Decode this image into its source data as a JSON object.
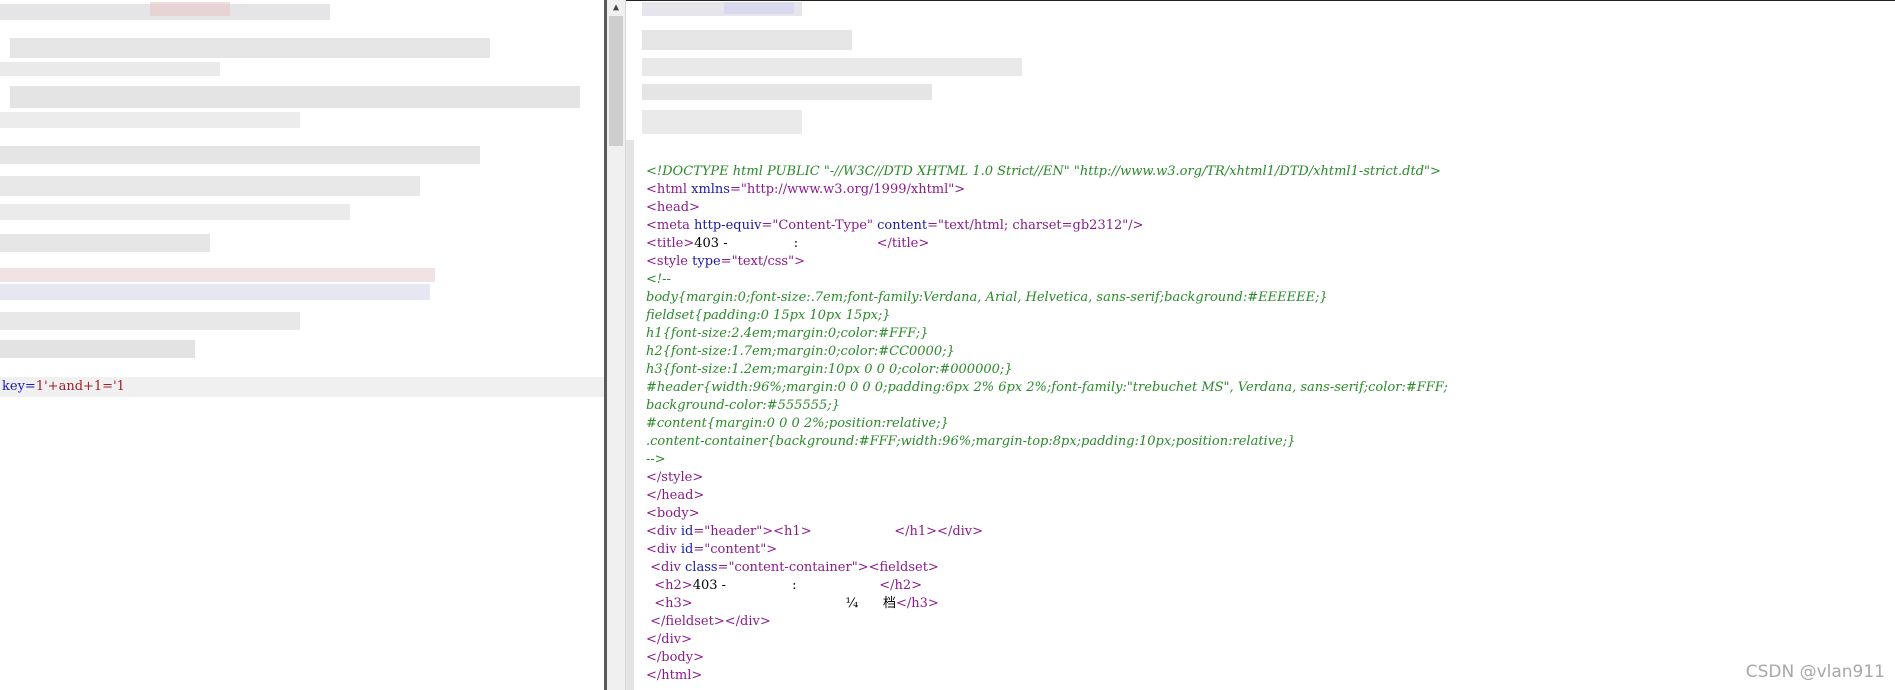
{
  "request": {
    "param_key": "key",
    "param_eq": "=",
    "param_value": "1'+and+1='1"
  },
  "response_lines": [
    [
      [
        "d",
        "<!DOCTYPE html PUBLIC \"-//W3C//DTD XHTML 1.0 Strict//EN\" \"http://www.w3.org/TR/xhtml1/DTD/xhtml1-strict.dtd\">"
      ]
    ],
    [
      [
        "t",
        "<html "
      ],
      [
        "a",
        "xmlns"
      ],
      [
        "t",
        "="
      ],
      [
        "v",
        "\"http://www.w3.org/1999/xhtml\""
      ],
      [
        "t",
        ">"
      ]
    ],
    [
      [
        "t",
        "<head>"
      ]
    ],
    [
      [
        "t",
        "<meta "
      ],
      [
        "a",
        "http-equiv"
      ],
      [
        "t",
        "="
      ],
      [
        "v",
        "\"Content-Type\" "
      ],
      [
        "a",
        "content"
      ],
      [
        "t",
        "="
      ],
      [
        "v",
        "\"text/html; charset=gb2312\""
      ],
      [
        "t",
        "/>"
      ]
    ],
    [
      [
        "t",
        "<title>"
      ],
      [
        "tx",
        "403 -                :                   "
      ],
      [
        "t",
        "</title>"
      ]
    ],
    [
      [
        "t",
        "<style "
      ],
      [
        "a",
        "type"
      ],
      [
        "t",
        "="
      ],
      [
        "v",
        "\"text/css\""
      ],
      [
        "t",
        ">"
      ]
    ],
    [
      [
        "c",
        "<!--"
      ]
    ],
    [
      [
        "c",
        "body{margin:0;font-size:.7em;font-family:Verdana, Arial, Helvetica, sans-serif;background:#EEEEEE;}"
      ]
    ],
    [
      [
        "c",
        "fieldset{padding:0 15px 10px 15px;}"
      ]
    ],
    [
      [
        "c",
        "h1{font-size:2.4em;margin:0;color:#FFF;}"
      ]
    ],
    [
      [
        "c",
        "h2{font-size:1.7em;margin:0;color:#CC0000;}"
      ]
    ],
    [
      [
        "c",
        "h3{font-size:1.2em;margin:10px 0 0 0;color:#000000;}"
      ]
    ],
    [
      [
        "c",
        "#header{width:96%;margin:0 0 0 0;padding:6px 2% 6px 2%;font-family:\"trebuchet MS\", Verdana, sans-serif;color:#FFF;"
      ]
    ],
    [
      [
        "c",
        "background-color:#555555;}"
      ]
    ],
    [
      [
        "c",
        "#content{margin:0 0 0 2%;position:relative;}"
      ]
    ],
    [
      [
        "c",
        ".content-container{background:#FFF;width:96%;margin-top:8px;padding:10px;position:relative;}"
      ]
    ],
    [
      [
        "c",
        "-->"
      ]
    ],
    [
      [
        "t",
        "</style>"
      ]
    ],
    [
      [
        "t",
        "</head>"
      ]
    ],
    [
      [
        "t",
        "<body>"
      ]
    ],
    [
      [
        "t",
        "<div "
      ],
      [
        "a",
        "id"
      ],
      [
        "t",
        "="
      ],
      [
        "v",
        "\"header\""
      ],
      [
        "t",
        "><h1>"
      ],
      [
        "tx",
        "                    "
      ],
      [
        "t",
        "</h1></div>"
      ]
    ],
    [
      [
        "t",
        "<div "
      ],
      [
        "a",
        "id"
      ],
      [
        "t",
        "="
      ],
      [
        "v",
        "\"content\""
      ],
      [
        "t",
        ">"
      ]
    ],
    [
      [
        "tx",
        " "
      ],
      [
        "t",
        "<div "
      ],
      [
        "a",
        "class"
      ],
      [
        "t",
        "="
      ],
      [
        "v",
        "\"content-container\""
      ],
      [
        "t",
        "><fieldset>"
      ]
    ],
    [
      [
        "tx",
        "  "
      ],
      [
        "t",
        "<h2>"
      ],
      [
        "tx",
        "403 -                :                    "
      ],
      [
        "t",
        "</h2>"
      ]
    ],
    [
      [
        "tx",
        "  "
      ],
      [
        "t",
        "<h3>"
      ],
      [
        "tx",
        "                                     ¼      档"
      ],
      [
        "t",
        "</h3>"
      ]
    ],
    [
      [
        "tx",
        " "
      ],
      [
        "t",
        "</fieldset></div>"
      ]
    ],
    [
      [
        "t",
        "</div>"
      ]
    ],
    [
      [
        "t",
        "</body>"
      ]
    ],
    [
      [
        "t",
        "</html>"
      ]
    ]
  ],
  "watermark": "CSDN @vlan911",
  "scrollbar": {
    "up_arrow": "▲"
  }
}
